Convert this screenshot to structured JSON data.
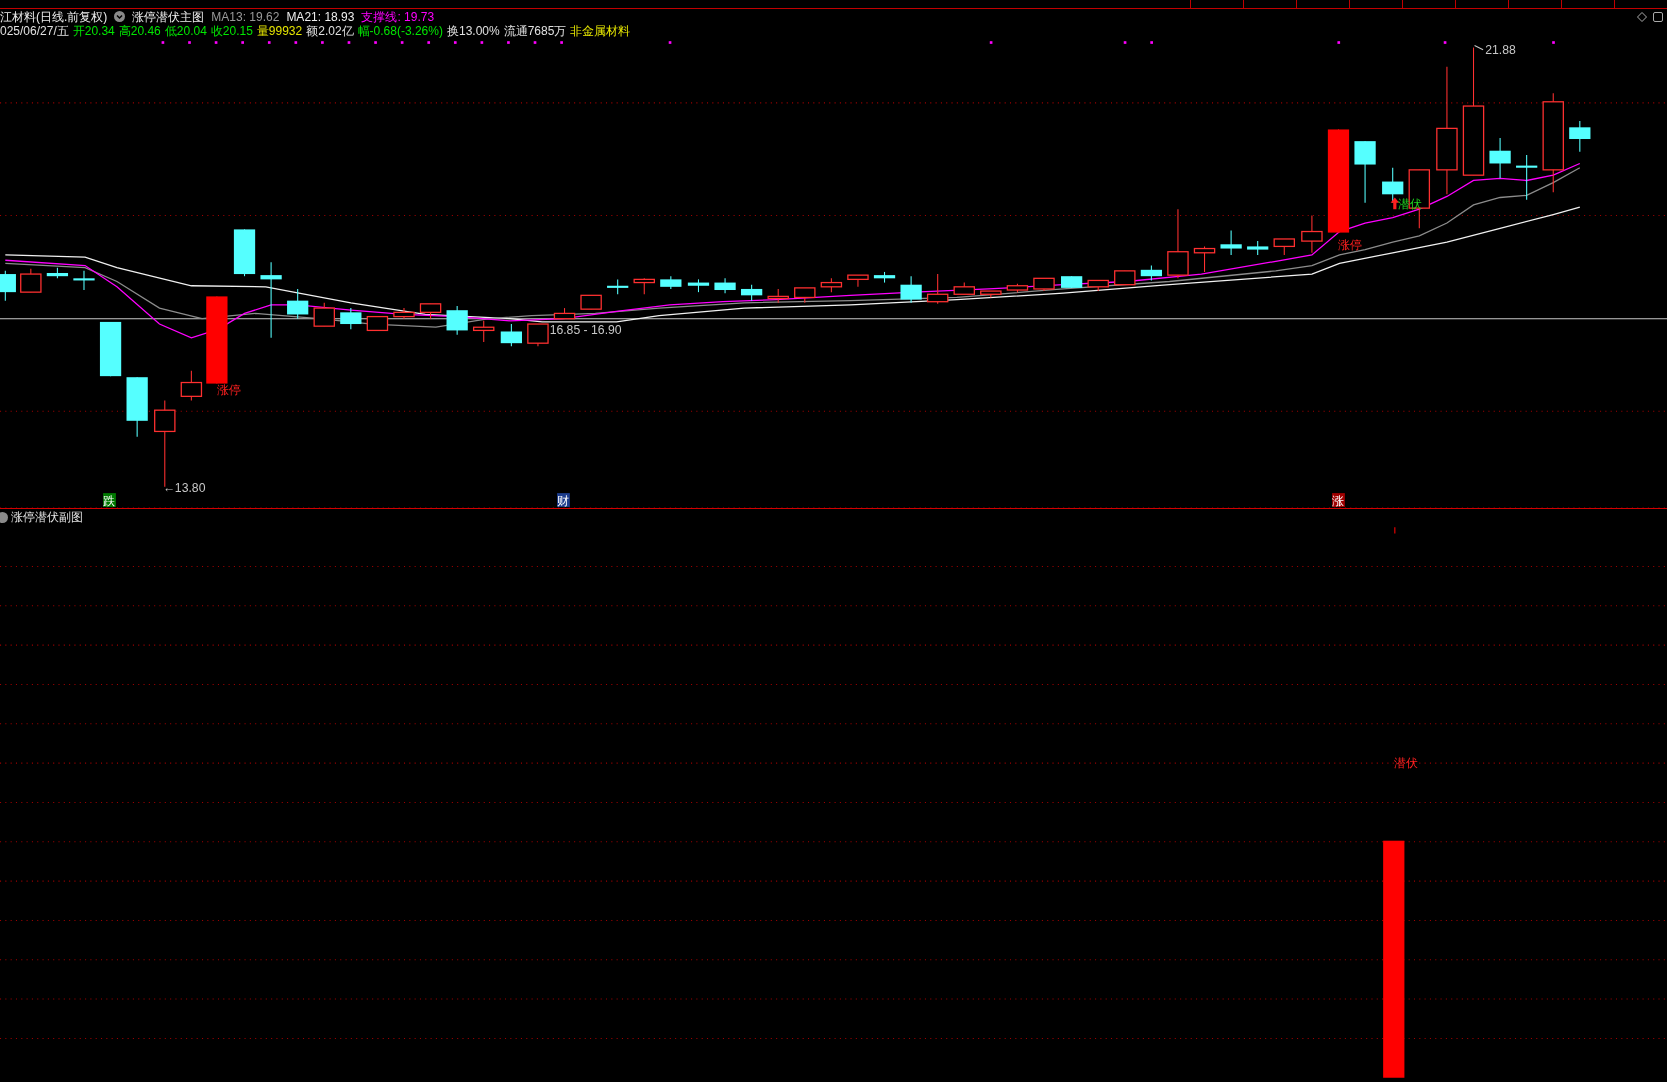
{
  "header": [
    {
      "text": "江材料(日线.前复权)"
    },
    {
      "text": "涨停潜伏主图"
    },
    {
      "text": "MA13: 19.62",
      "color": "#9a9a9a"
    },
    {
      "text": "MA21: 18.93"
    },
    {
      "text": "支撑线: 19.73",
      "color": "#ff00ff"
    }
  ],
  "quote": [
    {
      "text": "025/06/27/五",
      "color": "#e0e0e0"
    },
    {
      "text": "开20.34",
      "color": "#00e600"
    },
    {
      "text": "高20.46",
      "color": "#00e600"
    },
    {
      "text": "低20.04",
      "color": "#00e600"
    },
    {
      "text": "收20.15",
      "color": "#00e600"
    },
    {
      "text": "量99932",
      "color": "#e6e600"
    },
    {
      "text": "额2.02亿",
      "color": "#e0e0e0"
    },
    {
      "text": "幅-0.68(-3.26%)",
      "color": "#00e600"
    },
    {
      "text": "换13.00%",
      "color": "#e0e0e0"
    },
    {
      "text": "流通7685万",
      "color": "#e0e0e0"
    },
    {
      "text": "非金属材料",
      "color": "#e6e600"
    }
  ],
  "main_chart": {
    "annotations": [
      {
        "text": "涨停",
        "kind": "limit"
      },
      {
        "text": "←13.80",
        "kind": "price"
      },
      {
        "text": "16.85 - 16.90",
        "kind": "price"
      },
      {
        "text": "潜伏",
        "kind": "signal"
      },
      {
        "text": "涨停",
        "kind": "limit"
      },
      {
        "text": "21.88",
        "kind": "price"
      }
    ],
    "markers": [
      {
        "text": "跌",
        "color": "#007a00"
      },
      {
        "text": "财",
        "color": "#1c3c8c"
      },
      {
        "text": "涨",
        "color": "#a00000"
      }
    ]
  },
  "sub_chart": {
    "title": "涨停潜伏副图",
    "annotations": [
      {
        "text": "潜伏",
        "kind": "limit"
      }
    ]
  }
}
